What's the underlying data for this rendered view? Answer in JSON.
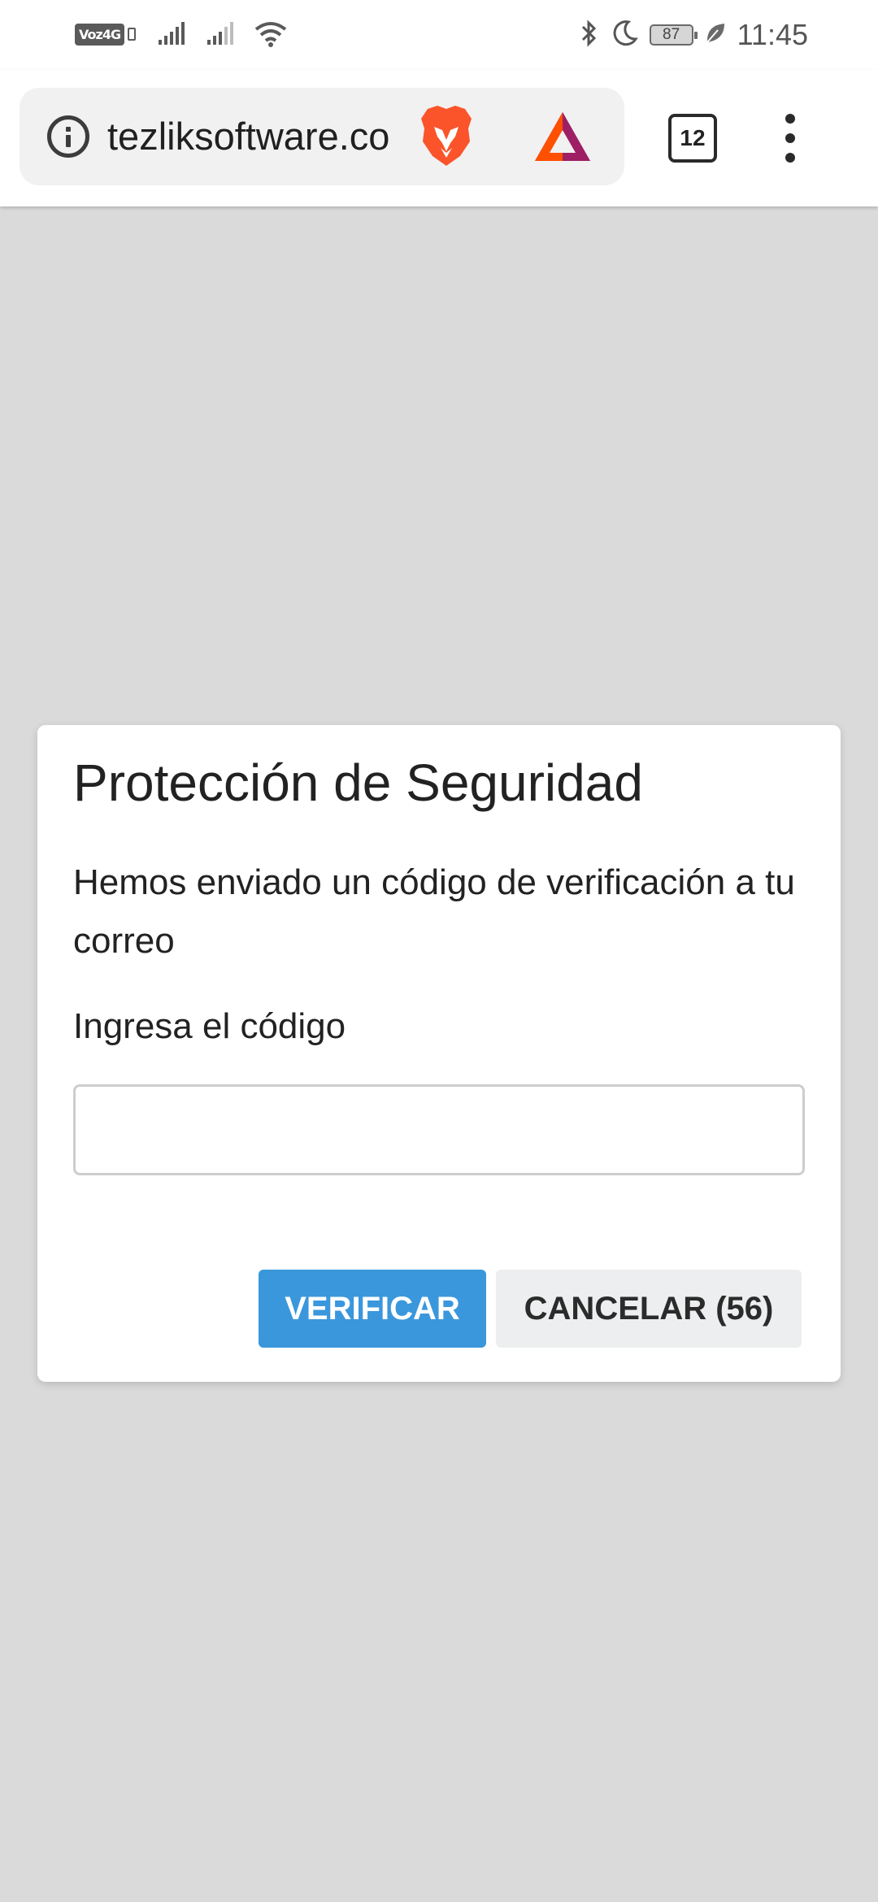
{
  "status_bar": {
    "network_label": "Voz4G",
    "battery": "87",
    "time": "11:45",
    "icons": [
      "volte-icon",
      "signal-icon",
      "signal-icon",
      "wifi-icon",
      "bluetooth-icon",
      "moon-icon",
      "battery-icon",
      "leaf-icon"
    ]
  },
  "browser": {
    "url": "tezliksoftware.co",
    "tab_count": "12",
    "icons": [
      "info-icon",
      "brave-lion-icon",
      "bat-triangle-icon",
      "menu-dots-icon"
    ]
  },
  "dialog": {
    "title": "Protección de Seguridad",
    "message": "Hemos enviado un código de verificación a tu correo",
    "input_label": "Ingresa el código",
    "input_value": "",
    "verify_label": "VERIFICAR",
    "cancel_label": "CANCELAR (56)"
  },
  "colors": {
    "overlay": "#dadada",
    "verify_button": "#3a97dc",
    "cancel_button": "#eceeef"
  }
}
